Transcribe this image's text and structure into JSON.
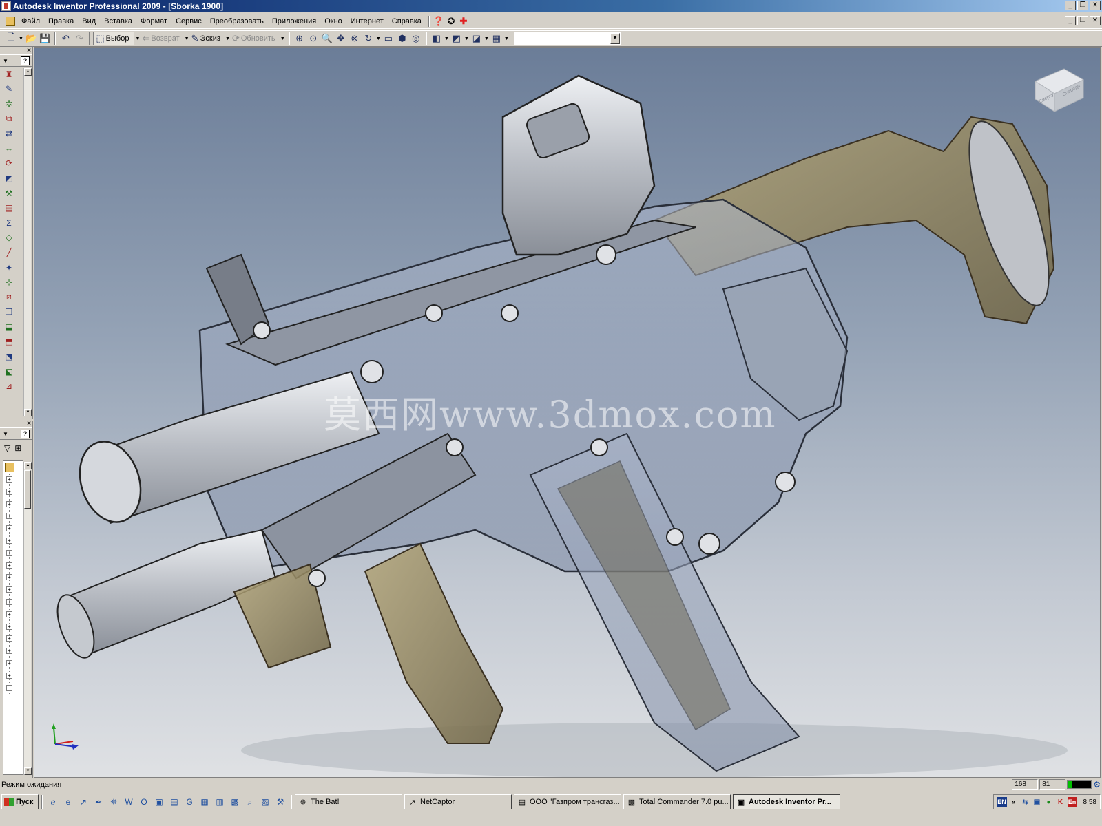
{
  "window": {
    "title": "Autodesk Inventor Professional 2009 - [Sborka 1900]",
    "controls": [
      "_",
      "❐",
      "✕"
    ]
  },
  "menu": {
    "items": [
      "Файл",
      "Правка",
      "Вид",
      "Вставка",
      "Формат",
      "Сервис",
      "Преобразовать",
      "Приложения",
      "Окно",
      "Интернет",
      "Справка"
    ],
    "doc_controls": [
      "_",
      "❐",
      "✕"
    ]
  },
  "toolbar": {
    "select_label": "Выбор",
    "return_label": "Возврат",
    "sketch_label": "Эскиз",
    "update_label": "Обновить",
    "combo_value": ""
  },
  "viewport": {
    "watermark": "莫西网www.3dmox.com",
    "viewcube_labels": [
      "Сверху",
      "Спереди"
    ],
    "background_top": "#6b7d98",
    "background_bottom": "#dfe1e4"
  },
  "status": {
    "text": "Режим ожидания",
    "field1": "168",
    "field2": "81",
    "memory_fraction": 0.2
  },
  "taskbar": {
    "start_label": "Пуск",
    "tasks": [
      {
        "label": "The Bat!",
        "icon": "bat-icon",
        "active": false
      },
      {
        "label": "NetCaptor",
        "icon": "browser-icon",
        "active": false
      },
      {
        "label": "ООО \"Газпром трансгаз...",
        "icon": "document-icon",
        "active": false
      },
      {
        "label": "Total Commander 7.0 pu...",
        "icon": "disk-icon",
        "active": false
      },
      {
        "label": "Autodesk Inventor Pr...",
        "icon": "inventor-icon",
        "active": true
      }
    ],
    "tray": {
      "lang1": "EN",
      "lang2": "En",
      "time": "8:58"
    }
  },
  "colors": {
    "titlebar": "#0a246a",
    "metal": "#c9ccd1",
    "tan_part": "#8a7a50"
  }
}
